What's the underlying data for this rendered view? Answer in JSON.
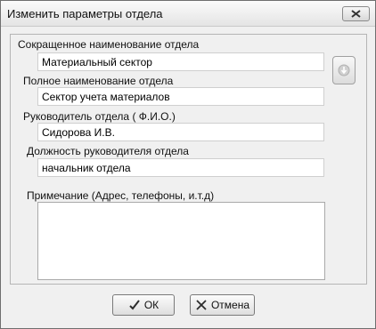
{
  "window": {
    "title": "Изменить параметры отдела"
  },
  "form": {
    "short_name": {
      "label": "Сокращенное наименование отдела",
      "value": "Материальный сектор"
    },
    "full_name": {
      "label": "Полное наименование отдела",
      "value": "Сектор учета материалов"
    },
    "head": {
      "label": "Руководитель отдела ( Ф.И.О.)",
      "value": "Сидорова И.В."
    },
    "head_position": {
      "label": "Должность руководителя отдела",
      "value": "начальник отдела"
    },
    "note": {
      "label": "Примечание (Адрес, телефоны, и.т.д)",
      "value": ""
    }
  },
  "buttons": {
    "ok": "ОК",
    "cancel": "Отмена"
  },
  "icons": {
    "close": "close-icon",
    "side": "down-arrow-icon",
    "ok": "checkmark-icon",
    "cancel": "x-icon"
  }
}
